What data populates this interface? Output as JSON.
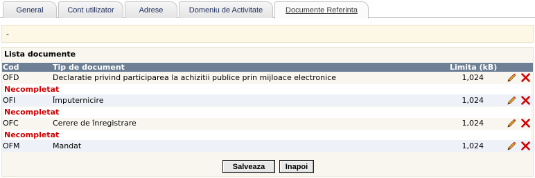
{
  "tabs": [
    {
      "label": "General"
    },
    {
      "label": "Cont utilizator"
    },
    {
      "label": "Adrese"
    },
    {
      "label": "Domeniu de Activitate"
    },
    {
      "label": "Documente Referinta",
      "active": true
    }
  ],
  "info": {
    "text": "-"
  },
  "panel": {
    "title": "Lista documente",
    "columns": {
      "cod": "Cod",
      "tip": "Tip de document",
      "limita": "Limita (kB)"
    },
    "rows": [
      {
        "cod": "OFD",
        "tip": "Declaratie privind participarea la achizitii publice prin mijloace electronice",
        "limita": "1,024"
      },
      {
        "cod": "OFI",
        "tip": "Împuternicire",
        "limita": "1,024"
      },
      {
        "cod": "OFC",
        "tip": "Cerere de înregistrare",
        "limita": "1,024"
      },
      {
        "cod": "OFM",
        "tip": "Mandat",
        "limita": "1,024"
      }
    ],
    "statuses": [
      "Necompletat",
      "Necompletat",
      "Necompletat"
    ]
  },
  "buttons": {
    "save": "Salveaza",
    "back": "Inapoi"
  },
  "colors": {
    "header_bg": "#6d7f95",
    "status_red": "#cc0000",
    "panel_bg": "#f8f6ef"
  },
  "icons": {
    "edit": "pencil-icon",
    "delete": "delete-x-icon"
  }
}
